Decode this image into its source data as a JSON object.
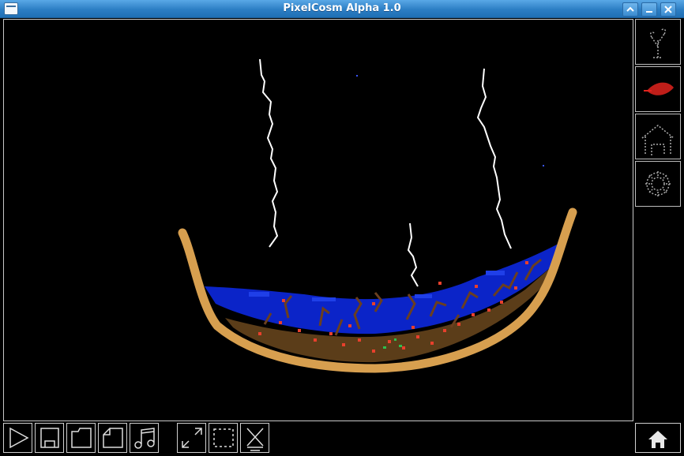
{
  "window": {
    "title": "PixelCosm Alpha 1.0"
  },
  "colors": {
    "vessel": "#d79f4f",
    "water": "#0b24c8",
    "soil": "#5b3d19",
    "roots": "#6b3f1f",
    "seeds": "#e8402c",
    "lightning": "#ffffff",
    "panel_border": "#cfcfcf"
  },
  "side_tools": [
    {
      "icon": "plant-icon"
    },
    {
      "icon": "leaf-icon"
    },
    {
      "icon": "house-icon"
    },
    {
      "icon": "gear-icon"
    }
  ],
  "toolbar": [
    {
      "icon": "play-icon"
    },
    {
      "icon": "save-icon"
    },
    {
      "icon": "open-folder-icon"
    },
    {
      "icon": "new-file-icon"
    },
    {
      "icon": "music-icon"
    },
    {
      "icon": "expand-icon"
    },
    {
      "icon": "select-icon"
    },
    {
      "icon": "clear-icon"
    },
    {
      "icon": "home-icon"
    }
  ]
}
